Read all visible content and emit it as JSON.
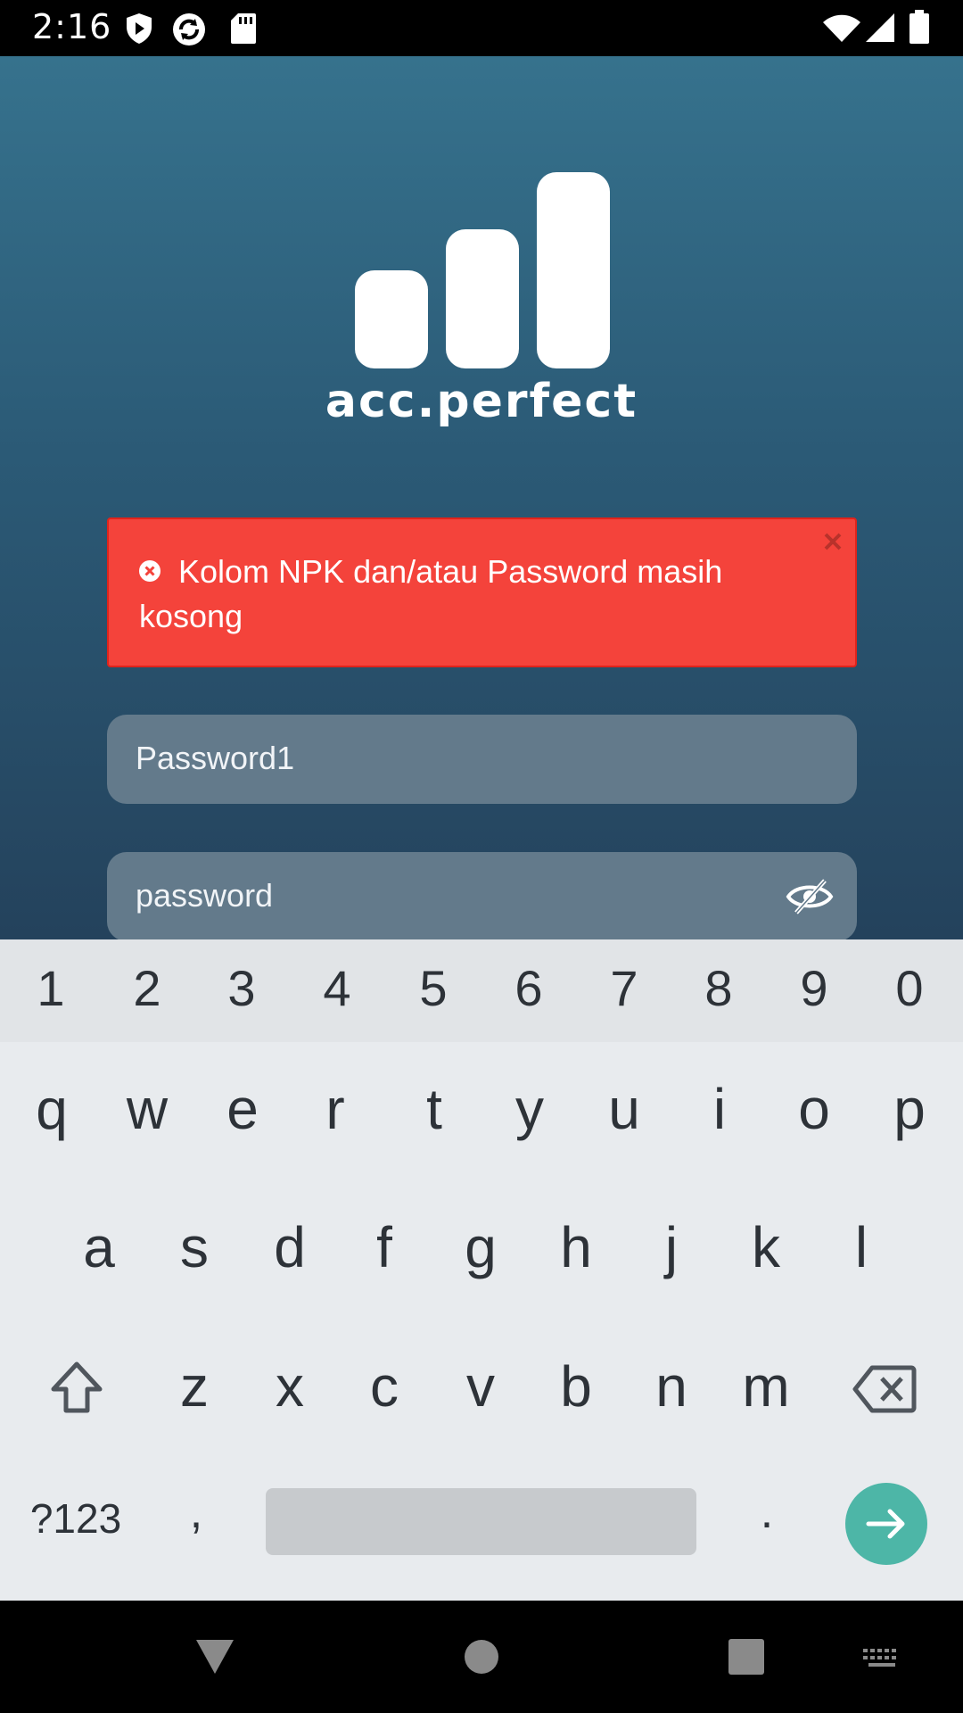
{
  "status_bar": {
    "time": "2:16"
  },
  "app": {
    "logo_text": "acc.perfect",
    "alert": {
      "message": "Kolom NPK dan/atau Password masih kosong"
    },
    "npk_field": {
      "value": "Password1"
    },
    "password_field": {
      "value": "password"
    }
  },
  "keyboard": {
    "number_row": [
      "1",
      "2",
      "3",
      "4",
      "5",
      "6",
      "7",
      "8",
      "9",
      "0"
    ],
    "row1": [
      "q",
      "w",
      "e",
      "r",
      "t",
      "y",
      "u",
      "i",
      "o",
      "p"
    ],
    "row2": [
      "a",
      "s",
      "d",
      "f",
      "g",
      "h",
      "j",
      "k",
      "l"
    ],
    "row3": [
      "z",
      "x",
      "c",
      "v",
      "b",
      "n",
      "m"
    ],
    "symbols_key": "?123",
    "comma_key": ",",
    "period_key": "."
  },
  "colors": {
    "alert_bg": "#f4433b",
    "field_bg": "#637a8b",
    "enter_key": "#4db6a7",
    "app_gradient_top": "#36728d",
    "app_gradient_bottom": "#24425c"
  }
}
